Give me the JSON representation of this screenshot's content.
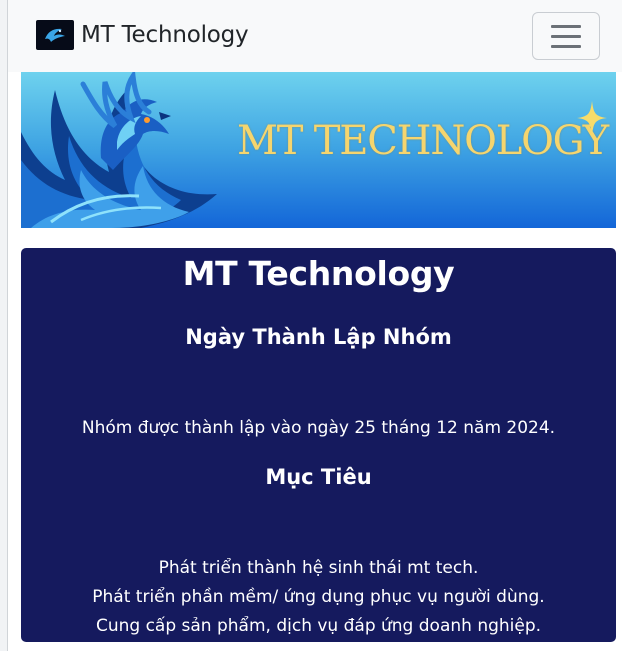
{
  "navbar": {
    "brand_text": "MT Technology",
    "logo_icon": "mt-logo-icon",
    "menu_icon": "hamburger-menu-icon"
  },
  "banner": {
    "title": "MT TECHNOLOGY",
    "colors": {
      "sky_top": "#6ed2ee",
      "sky_bottom": "#1366d8",
      "title_gold": "#f5d56e"
    }
  },
  "content": {
    "title": "MT Technology",
    "sections": [
      {
        "heading": "Ngày Thành Lập Nhóm",
        "lines": [
          "Nhóm được thành lập vào ngày 25 tháng 12 năm 2024."
        ]
      },
      {
        "heading": "Mục Tiêu",
        "lines": [
          "Phát triển thành hệ sinh thái mt tech.",
          "Phát triển phần mềm/ ứng dụng phục vụ người dùng.",
          "Cung cấp sản phẩm, dịch vụ đáp ứng doanh nghiệp."
        ]
      }
    ],
    "colors": {
      "card_background": "#151a5e",
      "text": "#ffffff"
    }
  }
}
